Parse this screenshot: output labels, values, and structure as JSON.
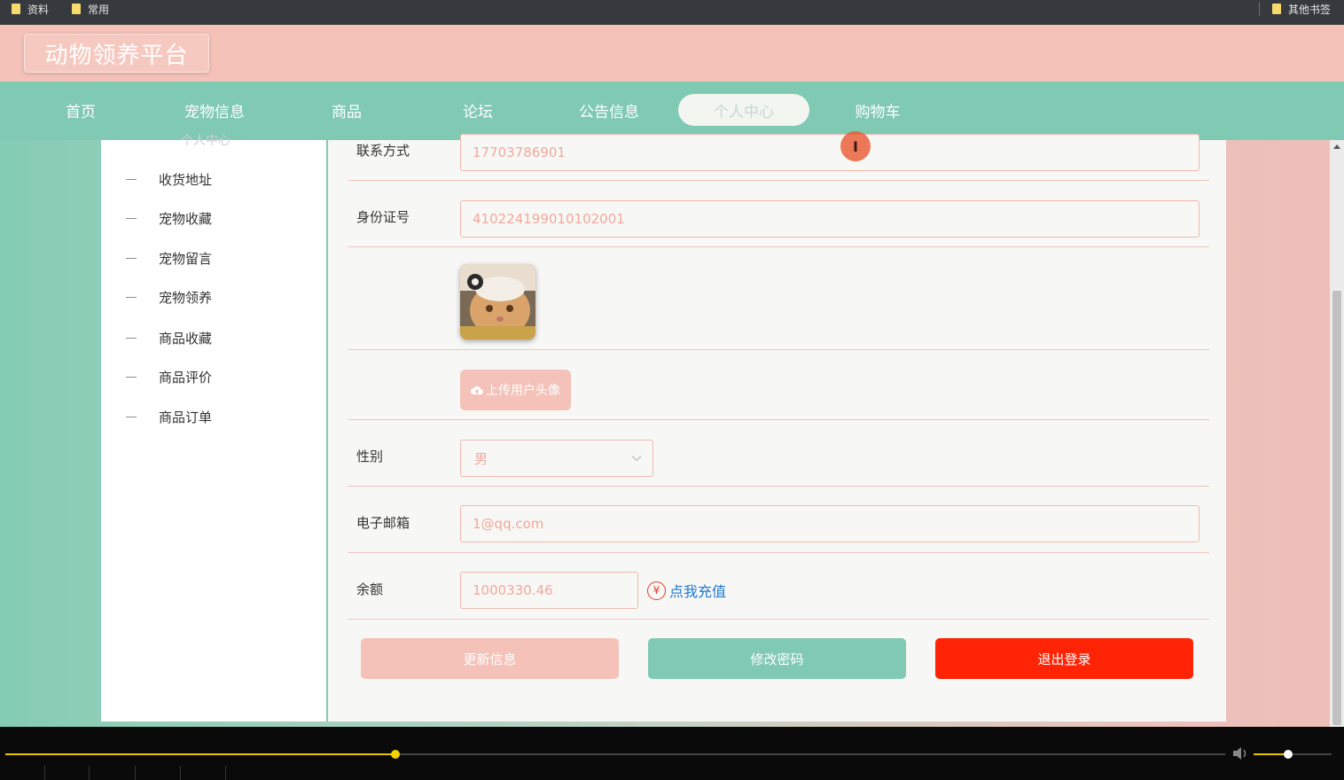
{
  "bookmarks": {
    "items": [
      "资料",
      "常用"
    ],
    "other": "其他书签"
  },
  "header": {
    "logo": "动物领养平台"
  },
  "nav": {
    "items": [
      {
        "label": "首页"
      },
      {
        "label": "宠物信息"
      },
      {
        "label": "商品"
      },
      {
        "label": "论坛"
      },
      {
        "label": "公告信息"
      },
      {
        "label": "个人中心",
        "active": true
      },
      {
        "label": "购物车"
      }
    ]
  },
  "sidebar": {
    "title": "个人中心",
    "items": [
      {
        "label": "收货地址"
      },
      {
        "label": "宠物收藏"
      },
      {
        "label": "宠物留言"
      },
      {
        "label": "宠物领养"
      },
      {
        "label": "商品收藏"
      },
      {
        "label": "商品评价"
      },
      {
        "label": "商品订单"
      }
    ]
  },
  "form": {
    "phone": {
      "label": "联系方式",
      "value": "17703786901"
    },
    "id_number": {
      "label": "身份证号",
      "value": "410224199010102001"
    },
    "upload_label": "上传用户头像",
    "gender": {
      "label": "性别",
      "value": "男"
    },
    "email": {
      "label": "电子邮箱",
      "value": "1@qq.com"
    },
    "balance": {
      "label": "余额",
      "value": "1000330.46"
    },
    "recharge_label": "点我充值",
    "recharge_icon": "¥"
  },
  "buttons": {
    "update": "更新信息",
    "change_password": "修改密码",
    "logout": "退出登录"
  },
  "cursor_glyph": "I",
  "player": {
    "progress": 0.32,
    "volume": 0.44
  },
  "colors": {
    "header_pink": "#f4c2b8",
    "nav_teal": "#80c9b3",
    "logout_red": "#ff2405",
    "link_blue": "#1e78d0"
  }
}
